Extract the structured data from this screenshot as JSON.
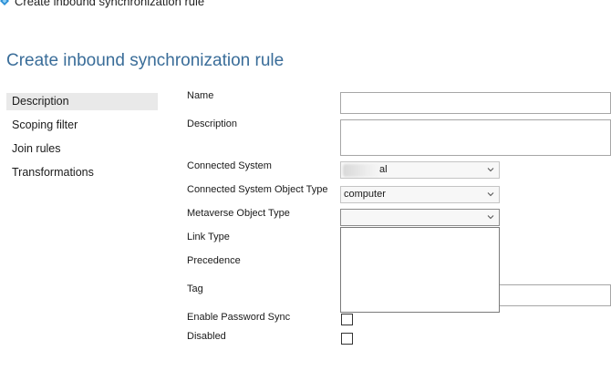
{
  "window": {
    "title": "Create inbound synchronization rule"
  },
  "page": {
    "title": "Create inbound synchronization rule"
  },
  "nav": {
    "items": [
      {
        "label": "Description",
        "selected": true
      },
      {
        "label": "Scoping filter",
        "selected": false
      },
      {
        "label": "Join rules",
        "selected": false
      },
      {
        "label": "Transformations",
        "selected": false
      }
    ]
  },
  "form": {
    "name_label": "Name",
    "name_value": "",
    "description_label": "Description",
    "description_value": "",
    "connected_system_label": "Connected System",
    "connected_system_value_visible": "al",
    "connected_system_object_type_label": "Connected System Object Type",
    "connected_system_object_type_value": "computer",
    "metaverse_object_type_label": "Metaverse Object Type",
    "metaverse_object_type_value": "",
    "link_type_label": "Link Type",
    "precedence_label": "Precedence",
    "tag_label": "Tag",
    "tag_value": "",
    "enable_password_sync_label": "Enable Password Sync",
    "enable_password_sync_checked": false,
    "disabled_label": "Disabled",
    "disabled_checked": false
  },
  "colors": {
    "title_accent": "#3a6d99",
    "nav_selected_bg": "#e9e9e9",
    "app_icon": "#2b8fd6"
  },
  "icons": {
    "app": "sync-diamond-icon",
    "dropdown": "chevron-down-icon"
  }
}
